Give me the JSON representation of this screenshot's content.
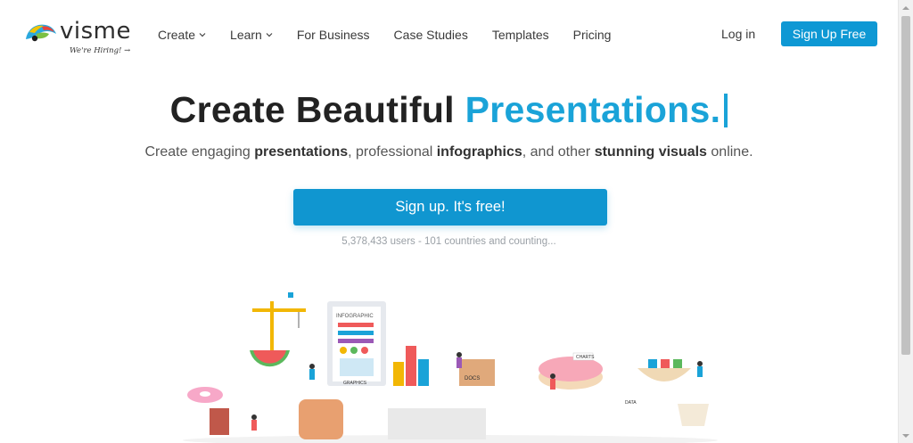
{
  "header": {
    "logo_text": "visme",
    "hiring_text": "We're Hiring! →",
    "nav": [
      {
        "label": "Create",
        "dropdown": true
      },
      {
        "label": "Learn",
        "dropdown": true
      },
      {
        "label": "For Business",
        "dropdown": false
      },
      {
        "label": "Case Studies",
        "dropdown": false
      },
      {
        "label": "Templates",
        "dropdown": false
      },
      {
        "label": "Pricing",
        "dropdown": false
      }
    ],
    "login_label": "Log in",
    "signup_label": "Sign Up Free"
  },
  "hero": {
    "title_main": "Create Beautiful ",
    "title_accent": "Presentations.",
    "subtitle_1": "Create engaging ",
    "subtitle_b1": "presentations",
    "subtitle_2": ", professional ",
    "subtitle_b2": "infographics",
    "subtitle_3": ", and other ",
    "subtitle_b3": "stunning visuals",
    "subtitle_4": " online.",
    "cta_label": "Sign up. It's free!",
    "users_text": "5,378,433 users - 101 countries and counting..."
  },
  "illustration": {
    "labels": [
      "INFOGRAPHIC",
      "GRAPHICS",
      "DOCS",
      "CHARTS",
      "DATA"
    ]
  },
  "colors": {
    "accent": "#1aa3d8",
    "button": "#0e98d4",
    "text_dark": "#222222"
  }
}
